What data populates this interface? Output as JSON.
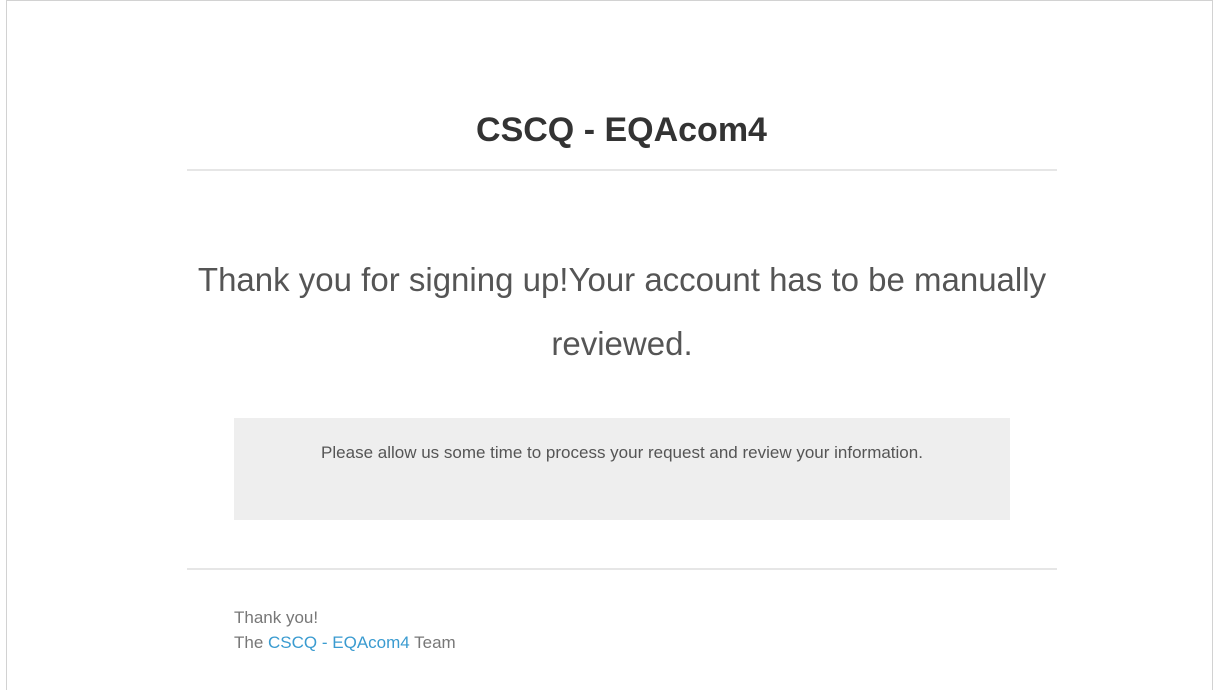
{
  "header": {
    "title": "CSCQ - EQAcom4"
  },
  "main": {
    "message": "Thank you for signing up!Your account has to be manually reviewed."
  },
  "notice": {
    "text": "Please allow us some time to process your request and review your information."
  },
  "footer": {
    "thanks": "Thank you!",
    "team_prefix": "The ",
    "team_link": "CSCQ - EQAcom4",
    "team_suffix": " Team"
  },
  "colors": {
    "link": "#3a9bd0",
    "notice_background": "#eeeeee",
    "rule": "#e6e6e6"
  }
}
